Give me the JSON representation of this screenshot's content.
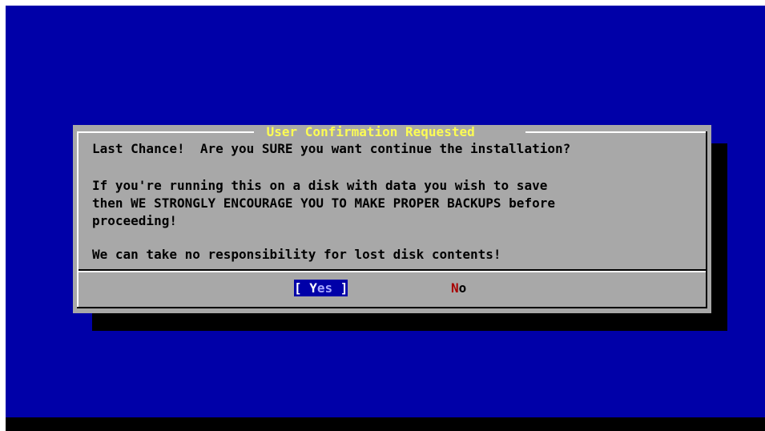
{
  "dialog": {
    "title": " User Confirmation Requested ",
    "lines": [
      "Last Chance!  Are you SURE you want continue the installation?",
      "If you're running this on a disk with data you wish to save",
      "then WE STRONGLY ENCOURAGE YOU TO MAKE PROPER BACKUPS before",
      "proceeding!",
      "We can take no responsibility for lost disk contents!"
    ],
    "buttons": {
      "yes": {
        "open": "[ ",
        "hotkey": "Y",
        "rest": "es",
        "close": " ]"
      },
      "no": {
        "hotkey": "N",
        "rest": "o"
      }
    }
  },
  "colors": {
    "background": "#0000a8",
    "dialog": "#a8a8a8",
    "title": "#fcfc54",
    "hotkey": "#a80000",
    "shadow": "#000000"
  }
}
